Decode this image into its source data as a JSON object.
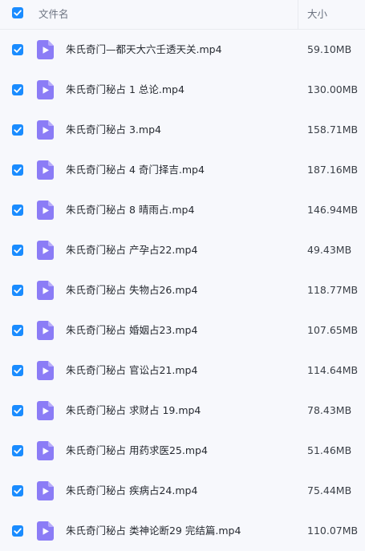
{
  "header": {
    "name_label": "文件名",
    "size_label": "大小",
    "select_all_checked": true
  },
  "colors": {
    "accent": "#1a8cff",
    "video_icon": "#8b7cf6",
    "background": "#f7f8fc"
  },
  "files": [
    {
      "name": "朱氏奇门—都天大六壬透天关.mp4",
      "size": "59.10MB",
      "checked": true,
      "icon": "video-file-icon"
    },
    {
      "name": "朱氏奇门秘占 1 总论.mp4",
      "size": "130.00MB",
      "checked": true,
      "icon": "video-file-icon"
    },
    {
      "name": "朱氏奇门秘占 3.mp4",
      "size": "158.71MB",
      "checked": true,
      "icon": "video-file-icon"
    },
    {
      "name": "朱氏奇门秘占 4 奇门择吉.mp4",
      "size": "187.16MB",
      "checked": true,
      "icon": "video-file-icon"
    },
    {
      "name": "朱氏奇门秘占 8 晴雨占.mp4",
      "size": "146.94MB",
      "checked": true,
      "icon": "video-file-icon"
    },
    {
      "name": "朱氏奇门秘占 产孕占22.mp4",
      "size": "49.43MB",
      "checked": true,
      "icon": "video-file-icon"
    },
    {
      "name": "朱氏奇门秘占 失物占26.mp4",
      "size": "118.77MB",
      "checked": true,
      "icon": "video-file-icon"
    },
    {
      "name": "朱氏奇门秘占 婚姻占23.mp4",
      "size": "107.65MB",
      "checked": true,
      "icon": "video-file-icon"
    },
    {
      "name": "朱氏奇门秘占 官讼占21.mp4",
      "size": "114.64MB",
      "checked": true,
      "icon": "video-file-icon"
    },
    {
      "name": "朱氏奇门秘占 求财占 19.mp4",
      "size": "78.43MB",
      "checked": true,
      "icon": "video-file-icon"
    },
    {
      "name": "朱氏奇门秘占 用药求医25.mp4",
      "size": "51.46MB",
      "checked": true,
      "icon": "video-file-icon"
    },
    {
      "name": "朱氏奇门秘占 疾病占24.mp4",
      "size": "75.44MB",
      "checked": true,
      "icon": "video-file-icon"
    },
    {
      "name": "朱氏奇门秘占 类神论断29 完结篇.mp4",
      "size": "110.07MB",
      "checked": true,
      "icon": "video-file-icon"
    }
  ]
}
